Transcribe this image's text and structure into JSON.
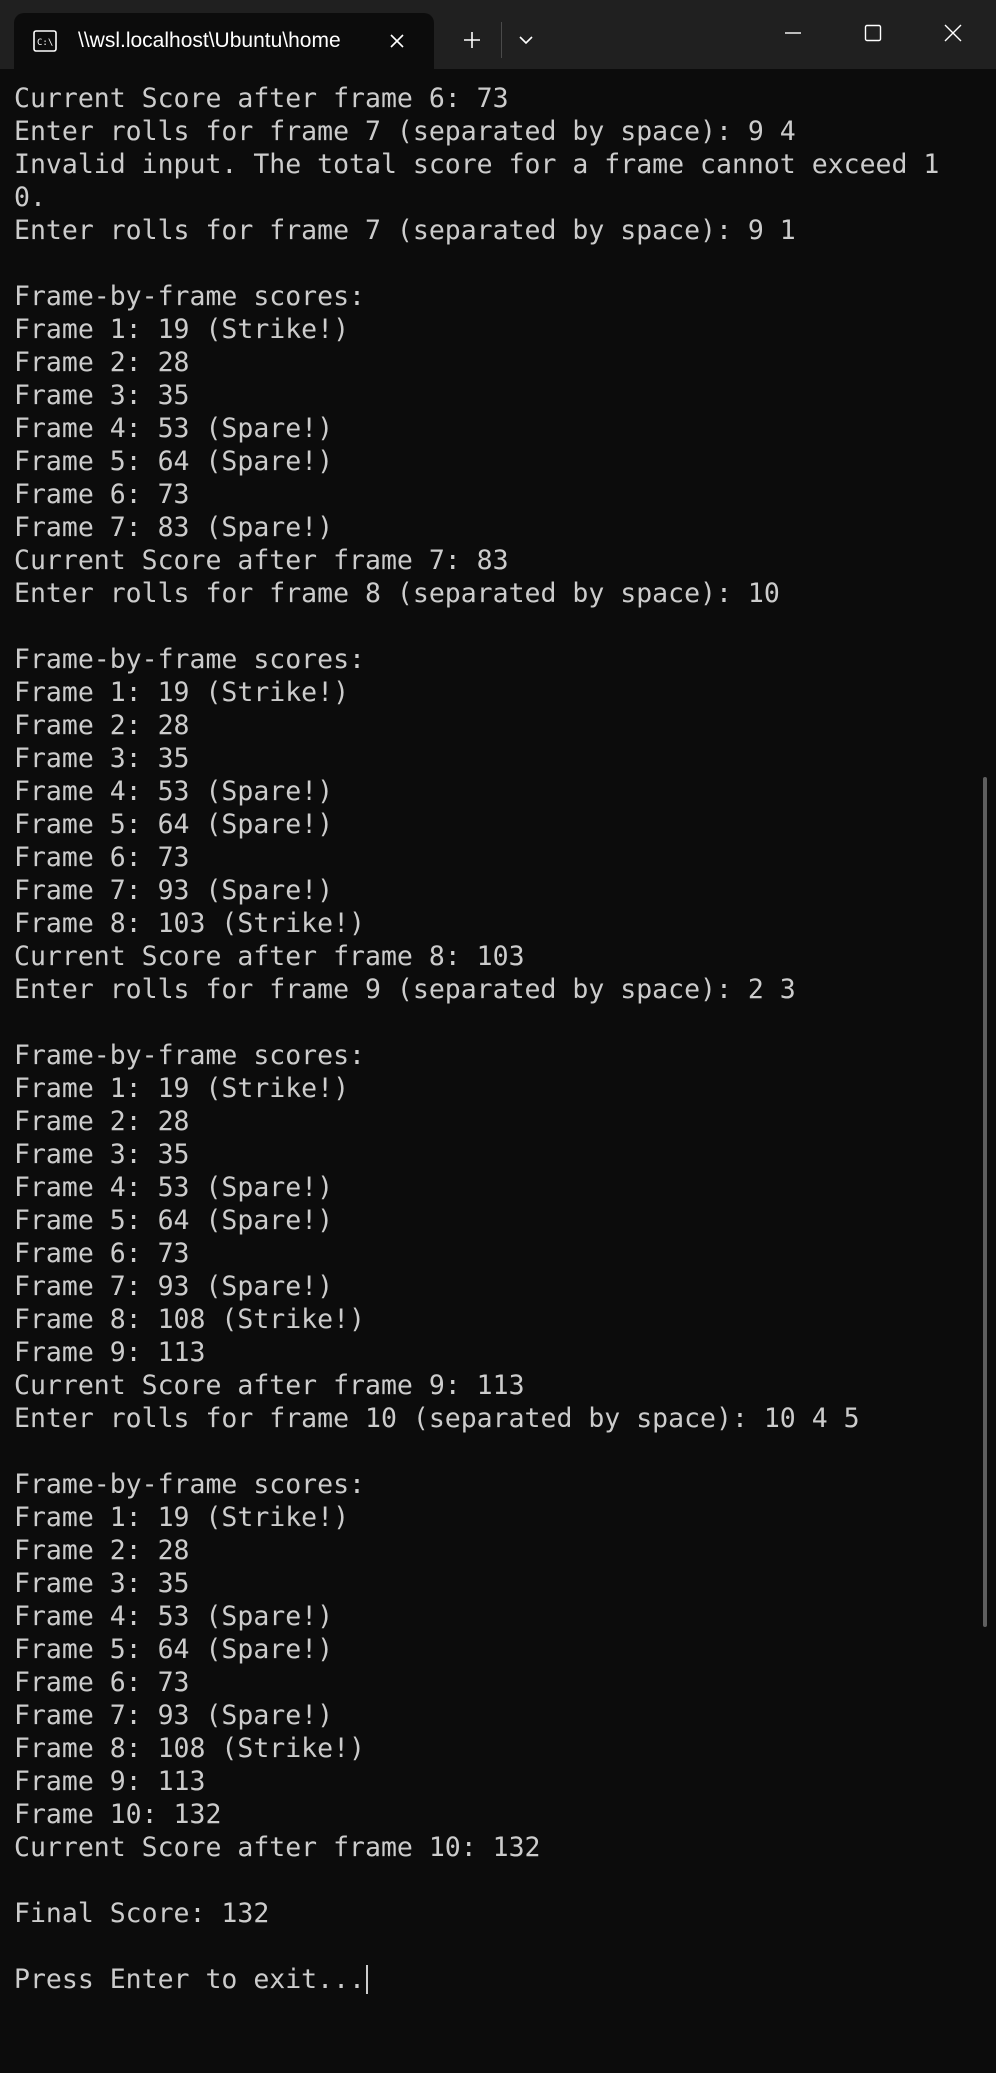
{
  "window": {
    "tab_title": "\\\\wsl.localhost\\Ubuntu\\home",
    "icons": {
      "tab": "terminal-icon",
      "tab_close": "close-icon",
      "new_tab": "plus-icon",
      "dropdown": "chevron-down-icon",
      "minimize": "minimize-icon",
      "maximize": "maximize-icon",
      "close": "close-icon"
    }
  },
  "colors": {
    "background": "#0c0c0c",
    "titlebar": "#202020",
    "text": "#cccccc"
  },
  "terminal": {
    "lines": [
      "Current Score after frame 6: 73",
      "Enter rolls for frame 7 (separated by space): 9 4",
      "Invalid input. The total score for a frame cannot exceed 1",
      "0.",
      "Enter rolls for frame 7 (separated by space): 9 1",
      "",
      "Frame-by-frame scores:",
      "Frame 1: 19 (Strike!)",
      "Frame 2: 28",
      "Frame 3: 35",
      "Frame 4: 53 (Spare!)",
      "Frame 5: 64 (Spare!)",
      "Frame 6: 73",
      "Frame 7: 83 (Spare!)",
      "Current Score after frame 7: 83",
      "Enter rolls for frame 8 (separated by space): 10",
      "",
      "Frame-by-frame scores:",
      "Frame 1: 19 (Strike!)",
      "Frame 2: 28",
      "Frame 3: 35",
      "Frame 4: 53 (Spare!)",
      "Frame 5: 64 (Spare!)",
      "Frame 6: 73",
      "Frame 7: 93 (Spare!)",
      "Frame 8: 103 (Strike!)",
      "Current Score after frame 8: 103",
      "Enter rolls for frame 9 (separated by space): 2 3",
      "",
      "Frame-by-frame scores:",
      "Frame 1: 19 (Strike!)",
      "Frame 2: 28",
      "Frame 3: 35",
      "Frame 4: 53 (Spare!)",
      "Frame 5: 64 (Spare!)",
      "Frame 6: 73",
      "Frame 7: 93 (Spare!)",
      "Frame 8: 108 (Strike!)",
      "Frame 9: 113",
      "Current Score after frame 9: 113",
      "Enter rolls for frame 10 (separated by space): 10 4 5",
      "",
      "Frame-by-frame scores:",
      "Frame 1: 19 (Strike!)",
      "Frame 2: 28",
      "Frame 3: 35",
      "Frame 4: 53 (Spare!)",
      "Frame 5: 64 (Spare!)",
      "Frame 6: 73",
      "Frame 7: 93 (Spare!)",
      "Frame 8: 108 (Strike!)",
      "Frame 9: 113",
      "Frame 10: 132",
      "Current Score after frame 10: 132",
      "",
      "Final Score: 132",
      ""
    ],
    "prompt": "Press Enter to exit..."
  }
}
